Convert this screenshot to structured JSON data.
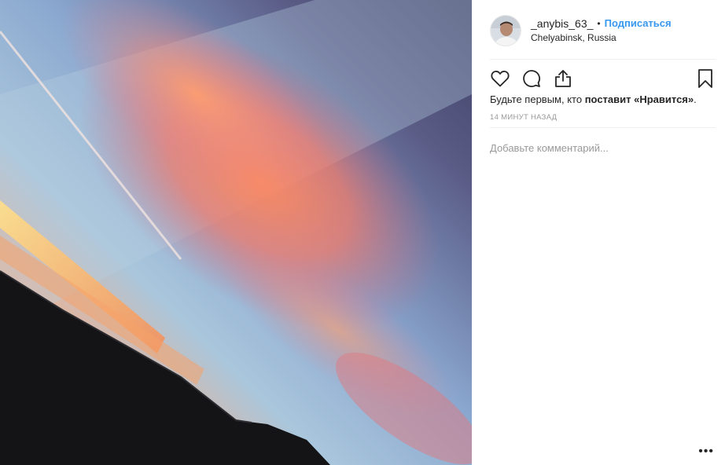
{
  "post": {
    "photo_alt": "sunset-sky-photo",
    "user": {
      "username": "_anybis_63_",
      "separator": "•",
      "follow_label": "Подписаться",
      "location": "Chelyabinsk, Russia"
    },
    "actions": {
      "like_icon": "heart-icon",
      "comment_icon": "comment-icon",
      "share_icon": "share-icon",
      "save_icon": "bookmark-icon"
    },
    "likes": {
      "prefix": "Будьте первым, кто ",
      "bold": "поставит «Нравится»",
      "suffix": "."
    },
    "timestamp": "14 минут назад",
    "comment_placeholder": "Добавьте комментарий...",
    "more_label": "•••"
  },
  "colors": {
    "follow": "#3897f0",
    "text": "#262626",
    "muted": "#999999",
    "divider": "#efefef"
  }
}
